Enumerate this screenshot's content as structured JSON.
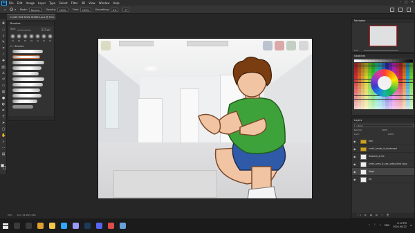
{
  "menubar": {
    "app_icon": "Ps",
    "items": [
      "File",
      "Edit",
      "Image",
      "Layer",
      "Type",
      "Select",
      "Filter",
      "3D",
      "View",
      "Window",
      "Help"
    ],
    "window_controls": [
      "–",
      "□",
      "✕"
    ]
  },
  "options": {
    "mode_label": "Mode:",
    "mode_value": "Normal",
    "opacity_label": "Opacity:",
    "opacity_value": "100%",
    "flow_label": "Flow:",
    "flow_value": "100%",
    "smoothing_label": "Smoothing:",
    "smoothing_value": "0%",
    "angle_value": "0°"
  },
  "document": {
    "tab_title": "C:\\USE ONE NOW SEXBE5.psd @ 50% (fox, RGB/8)"
  },
  "tools": [
    "move-tool",
    "marquee-tool",
    "lasso-tool",
    "quick-select-tool",
    "crop-tool",
    "eyedropper-tool",
    "healing-tool",
    "brush-tool",
    "stamp-tool",
    "history-brush-tool",
    "eraser-tool",
    "gradient-tool",
    "blur-tool",
    "dodge-tool",
    "pen-tool",
    "type-tool",
    "path-select-tool",
    "shape-tool",
    "hand-tool",
    "zoom-tool",
    "more-tool",
    "edit-toolbar-tool"
  ],
  "brushes": {
    "title": "Brushes",
    "size_label": "Size:",
    "size_value": "175 px",
    "tip_sizes": [
      "70",
      "60",
      "50",
      "40",
      "40",
      "30",
      "70"
    ],
    "group_name": "Brushes",
    "stroke_count": 11
  },
  "navigator": {
    "title": "Navigator",
    "zoom": "50%"
  },
  "swatches": {
    "title": "Swatches"
  },
  "layers": {
    "title": "Layers",
    "kind_filter": "Kind",
    "blend_mode": "Normal",
    "opacity": "100%",
    "lock_label": "Lock:",
    "fill": "100%",
    "rows": [
      {
        "name": "tom",
        "type": "folder",
        "selected": false
      },
      {
        "name": "smth_hands_it_shadowed",
        "type": "folder",
        "selected": false
      },
      {
        "name": "dissolve_arms",
        "type": "layer",
        "selected": false
      },
      {
        "name": "smth_arms_it_sex_untouched copy",
        "type": "layer",
        "selected": false
      },
      {
        "name": "bbge",
        "type": "layer",
        "selected": true
      },
      {
        "name": "bg",
        "type": "layer",
        "selected": false
      }
    ],
    "footer_icons": "fx ◐ ▣ ▤ + 🗑"
  },
  "status": {
    "zoom": "50%",
    "doc_size": "Doc: 24.9M/1.54G"
  },
  "taskbar": {
    "apps": [
      {
        "name": "search",
        "color": "#3b3b3b"
      },
      {
        "name": "task-view",
        "color": "#3b3b3b"
      },
      {
        "name": "chrome",
        "color": "#e0a030"
      },
      {
        "name": "file-explorer",
        "color": "#f2c84b"
      },
      {
        "name": "photoshop",
        "color": "#31a8ff"
      },
      {
        "name": "premiere",
        "color": "#9999ff"
      },
      {
        "name": "steam",
        "color": "#1c3b5a"
      },
      {
        "name": "discord",
        "color": "#5865f2"
      },
      {
        "name": "media-player",
        "color": "#e04c4c"
      },
      {
        "name": "notepad",
        "color": "#6aa0d8"
      }
    ],
    "language": "ENG",
    "time": "2:19 PM",
    "date": "2020-08-22"
  }
}
